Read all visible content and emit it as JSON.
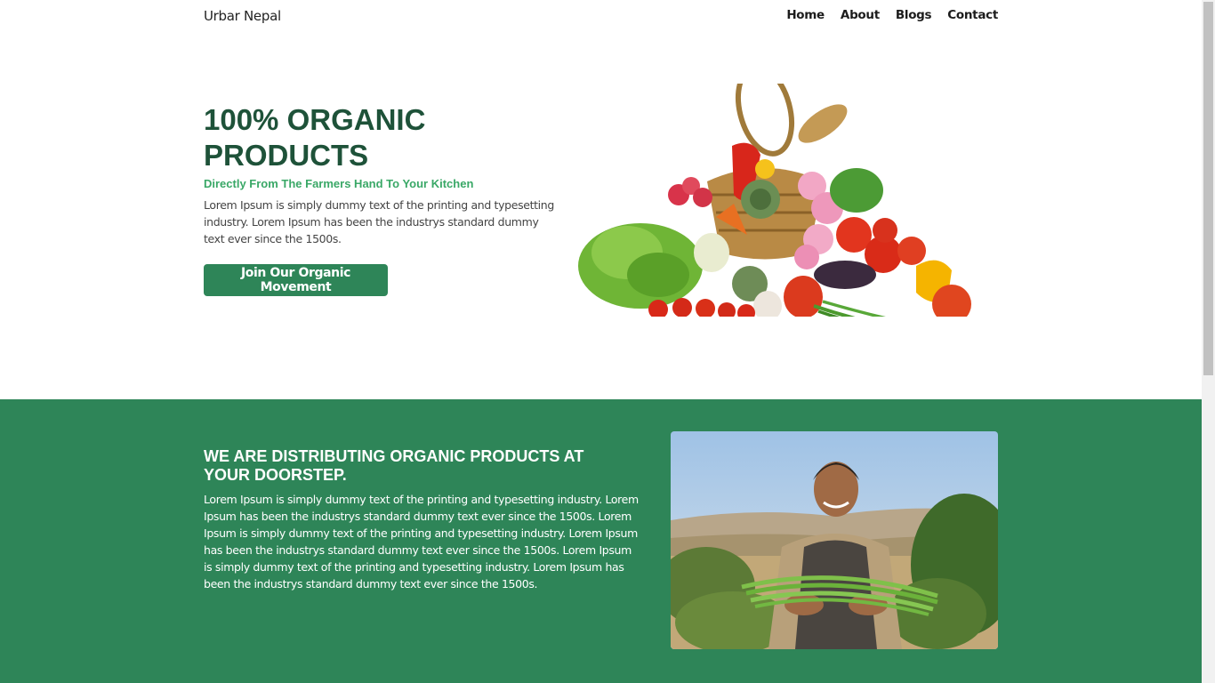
{
  "navbar": {
    "brand": "Urbar Nepal",
    "links": [
      "Home",
      "About",
      "Blogs",
      "Contact"
    ]
  },
  "hero": {
    "title": "100% ORGANIC PRODUCTS",
    "subtitle": "Directly From The Farmers Hand To Your Kitchen",
    "text": "Lorem Ipsum is simply dummy text of the printing and typesetting industry. Lorem Ipsum has been the industrys standard dummy text ever since the 1500s.",
    "cta_label": "Join Our Organic Movement"
  },
  "distribution": {
    "title": "WE ARE DISTRIBUTING ORGANIC PRODUCTS AT YOUR DOORSTEP.",
    "text": "Lorem Ipsum is simply dummy text of the printing and typesetting industry. Lorem Ipsum has been the industrys standard dummy text ever since the 1500s. Lorem Ipsum is simply dummy text of the printing and typesetting industry. Lorem Ipsum has been the industrys standard dummy text ever since the 1500s. Lorem Ipsum is simply dummy text of the printing and typesetting industry. Lorem Ipsum has been the industrys standard dummy text ever since the 1500s."
  },
  "colors": {
    "primary_green": "#2e8558",
    "dark_green_heading": "#1e5239",
    "accent_green": "#3aa867"
  }
}
